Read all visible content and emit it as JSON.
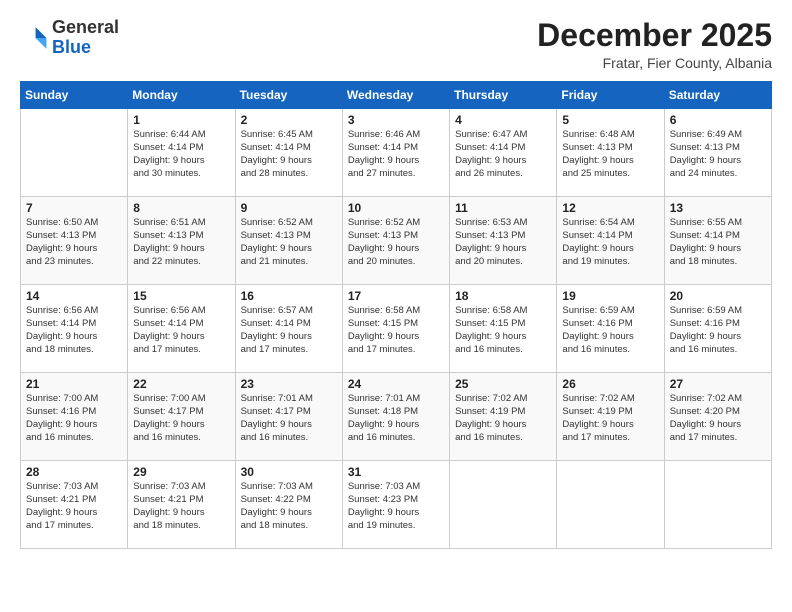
{
  "header": {
    "logo_general": "General",
    "logo_blue": "Blue",
    "month_title": "December 2025",
    "location": "Fratar, Fier County, Albania"
  },
  "days_of_week": [
    "Sunday",
    "Monday",
    "Tuesday",
    "Wednesday",
    "Thursday",
    "Friday",
    "Saturday"
  ],
  "weeks": [
    [
      {
        "day": "",
        "info": ""
      },
      {
        "day": "1",
        "info": "Sunrise: 6:44 AM\nSunset: 4:14 PM\nDaylight: 9 hours\nand 30 minutes."
      },
      {
        "day": "2",
        "info": "Sunrise: 6:45 AM\nSunset: 4:14 PM\nDaylight: 9 hours\nand 28 minutes."
      },
      {
        "day": "3",
        "info": "Sunrise: 6:46 AM\nSunset: 4:14 PM\nDaylight: 9 hours\nand 27 minutes."
      },
      {
        "day": "4",
        "info": "Sunrise: 6:47 AM\nSunset: 4:14 PM\nDaylight: 9 hours\nand 26 minutes."
      },
      {
        "day": "5",
        "info": "Sunrise: 6:48 AM\nSunset: 4:13 PM\nDaylight: 9 hours\nand 25 minutes."
      },
      {
        "day": "6",
        "info": "Sunrise: 6:49 AM\nSunset: 4:13 PM\nDaylight: 9 hours\nand 24 minutes."
      }
    ],
    [
      {
        "day": "7",
        "info": "Sunrise: 6:50 AM\nSunset: 4:13 PM\nDaylight: 9 hours\nand 23 minutes."
      },
      {
        "day": "8",
        "info": "Sunrise: 6:51 AM\nSunset: 4:13 PM\nDaylight: 9 hours\nand 22 minutes."
      },
      {
        "day": "9",
        "info": "Sunrise: 6:52 AM\nSunset: 4:13 PM\nDaylight: 9 hours\nand 21 minutes."
      },
      {
        "day": "10",
        "info": "Sunrise: 6:52 AM\nSunset: 4:13 PM\nDaylight: 9 hours\nand 20 minutes."
      },
      {
        "day": "11",
        "info": "Sunrise: 6:53 AM\nSunset: 4:13 PM\nDaylight: 9 hours\nand 20 minutes."
      },
      {
        "day": "12",
        "info": "Sunrise: 6:54 AM\nSunset: 4:14 PM\nDaylight: 9 hours\nand 19 minutes."
      },
      {
        "day": "13",
        "info": "Sunrise: 6:55 AM\nSunset: 4:14 PM\nDaylight: 9 hours\nand 18 minutes."
      }
    ],
    [
      {
        "day": "14",
        "info": "Sunrise: 6:56 AM\nSunset: 4:14 PM\nDaylight: 9 hours\nand 18 minutes."
      },
      {
        "day": "15",
        "info": "Sunrise: 6:56 AM\nSunset: 4:14 PM\nDaylight: 9 hours\nand 17 minutes."
      },
      {
        "day": "16",
        "info": "Sunrise: 6:57 AM\nSunset: 4:14 PM\nDaylight: 9 hours\nand 17 minutes."
      },
      {
        "day": "17",
        "info": "Sunrise: 6:58 AM\nSunset: 4:15 PM\nDaylight: 9 hours\nand 17 minutes."
      },
      {
        "day": "18",
        "info": "Sunrise: 6:58 AM\nSunset: 4:15 PM\nDaylight: 9 hours\nand 16 minutes."
      },
      {
        "day": "19",
        "info": "Sunrise: 6:59 AM\nSunset: 4:16 PM\nDaylight: 9 hours\nand 16 minutes."
      },
      {
        "day": "20",
        "info": "Sunrise: 6:59 AM\nSunset: 4:16 PM\nDaylight: 9 hours\nand 16 minutes."
      }
    ],
    [
      {
        "day": "21",
        "info": "Sunrise: 7:00 AM\nSunset: 4:16 PM\nDaylight: 9 hours\nand 16 minutes."
      },
      {
        "day": "22",
        "info": "Sunrise: 7:00 AM\nSunset: 4:17 PM\nDaylight: 9 hours\nand 16 minutes."
      },
      {
        "day": "23",
        "info": "Sunrise: 7:01 AM\nSunset: 4:17 PM\nDaylight: 9 hours\nand 16 minutes."
      },
      {
        "day": "24",
        "info": "Sunrise: 7:01 AM\nSunset: 4:18 PM\nDaylight: 9 hours\nand 16 minutes."
      },
      {
        "day": "25",
        "info": "Sunrise: 7:02 AM\nSunset: 4:19 PM\nDaylight: 9 hours\nand 16 minutes."
      },
      {
        "day": "26",
        "info": "Sunrise: 7:02 AM\nSunset: 4:19 PM\nDaylight: 9 hours\nand 17 minutes."
      },
      {
        "day": "27",
        "info": "Sunrise: 7:02 AM\nSunset: 4:20 PM\nDaylight: 9 hours\nand 17 minutes."
      }
    ],
    [
      {
        "day": "28",
        "info": "Sunrise: 7:03 AM\nSunset: 4:21 PM\nDaylight: 9 hours\nand 17 minutes."
      },
      {
        "day": "29",
        "info": "Sunrise: 7:03 AM\nSunset: 4:21 PM\nDaylight: 9 hours\nand 18 minutes."
      },
      {
        "day": "30",
        "info": "Sunrise: 7:03 AM\nSunset: 4:22 PM\nDaylight: 9 hours\nand 18 minutes."
      },
      {
        "day": "31",
        "info": "Sunrise: 7:03 AM\nSunset: 4:23 PM\nDaylight: 9 hours\nand 19 minutes."
      },
      {
        "day": "",
        "info": ""
      },
      {
        "day": "",
        "info": ""
      },
      {
        "day": "",
        "info": ""
      }
    ]
  ]
}
